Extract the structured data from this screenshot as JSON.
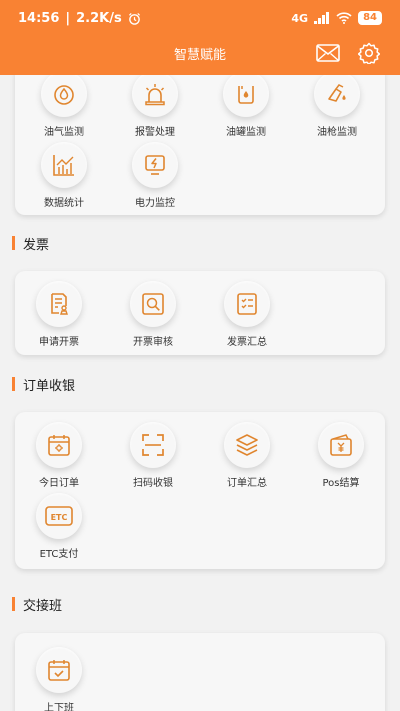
{
  "status_bar": {
    "time": "14:56",
    "speed": "2.2K/s",
    "network": "4G",
    "battery": "84"
  },
  "header": {
    "title": "智慧赋能"
  },
  "sections": {
    "monitor": {
      "items": [
        {
          "label": "油气监测",
          "icon": "oil-gas-icon"
        },
        {
          "label": "报警处理",
          "icon": "alarm-icon"
        },
        {
          "label": "油罐监测",
          "icon": "tank-icon"
        },
        {
          "label": "油枪监测",
          "icon": "nozzle-icon"
        },
        {
          "label": "数据统计",
          "icon": "statistics-icon"
        },
        {
          "label": "电力监控",
          "icon": "power-icon"
        }
      ]
    },
    "invoice": {
      "title": "发票",
      "items": [
        {
          "label": "申请开票",
          "icon": "apply-invoice-icon"
        },
        {
          "label": "开票审核",
          "icon": "review-invoice-icon"
        },
        {
          "label": "发票汇总",
          "icon": "invoice-summary-icon"
        }
      ]
    },
    "order": {
      "title": "订单收银",
      "items": [
        {
          "label": "今日订单",
          "icon": "calendar-sun-icon"
        },
        {
          "label": "扫码收银",
          "icon": "scan-icon"
        },
        {
          "label": "订单汇总",
          "icon": "layers-icon"
        },
        {
          "label": "Pos结算",
          "icon": "wallet-icon"
        },
        {
          "label": "ETC支付",
          "icon": "etc-icon"
        }
      ]
    },
    "shift": {
      "title": "交接班",
      "items": [
        {
          "label": "上下班",
          "icon": "calendar-check-icon"
        }
      ]
    }
  },
  "colors": {
    "accent": "#f98233",
    "background": "#f2f2f2",
    "card": "#f7f7f7"
  }
}
